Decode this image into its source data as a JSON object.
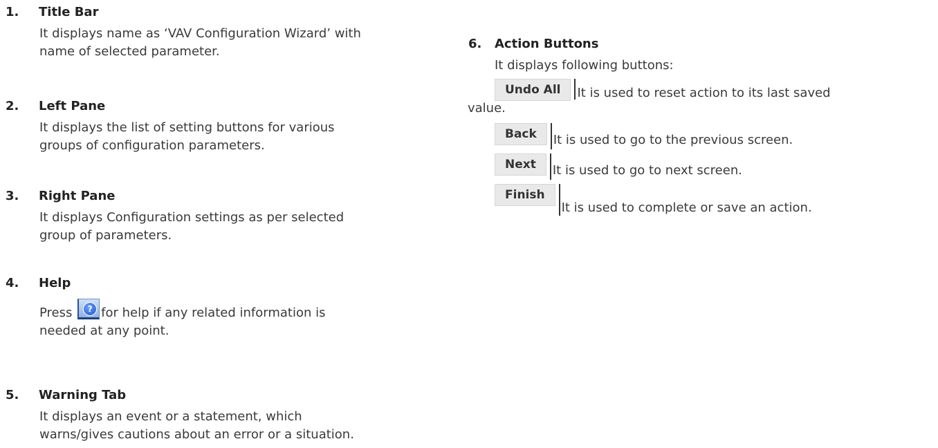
{
  "left_items": [
    {
      "number": "1.",
      "title": "Title Bar",
      "body_lines": [
        "It displays name as ‘VAV Configuration Wizard’ with",
        "name of selected parameter."
      ]
    },
    {
      "number": "2.",
      "title": "Left Pane",
      "body_lines": [
        "It displays the list of setting buttons for various",
        "groups of configuration parameters."
      ]
    },
    {
      "number": "3.",
      "title": "Right Pane",
      "body_lines": [
        "It displays Configuration settings as per selected",
        "group of parameters."
      ]
    },
    {
      "number": "4.",
      "title": "Help",
      "press_text": "Press",
      "press_suffix": "for help if any related information is",
      "body_line2": "needed at any point.",
      "icon": "help-question-icon"
    },
    {
      "number": "5.",
      "title": "Warning Tab",
      "body_lines": [
        "It displays an event or a statement, which",
        "warns/gives cautions about an error or a situation."
      ]
    }
  ],
  "right_item": {
    "number": "6.",
    "title": "Action Buttons",
    "intro": "It displays following buttons:",
    "buttons": [
      {
        "label": "Undo All",
        "desc": "It is used to reset action to its last saved",
        "desc_cont": "value."
      },
      {
        "label": "Back",
        "desc": "It is used to go to the previous screen."
      },
      {
        "label": "Next",
        "desc": "It is used to go to next screen."
      },
      {
        "label": "Finish",
        "desc": "It is used to complete or save an action."
      }
    ]
  }
}
